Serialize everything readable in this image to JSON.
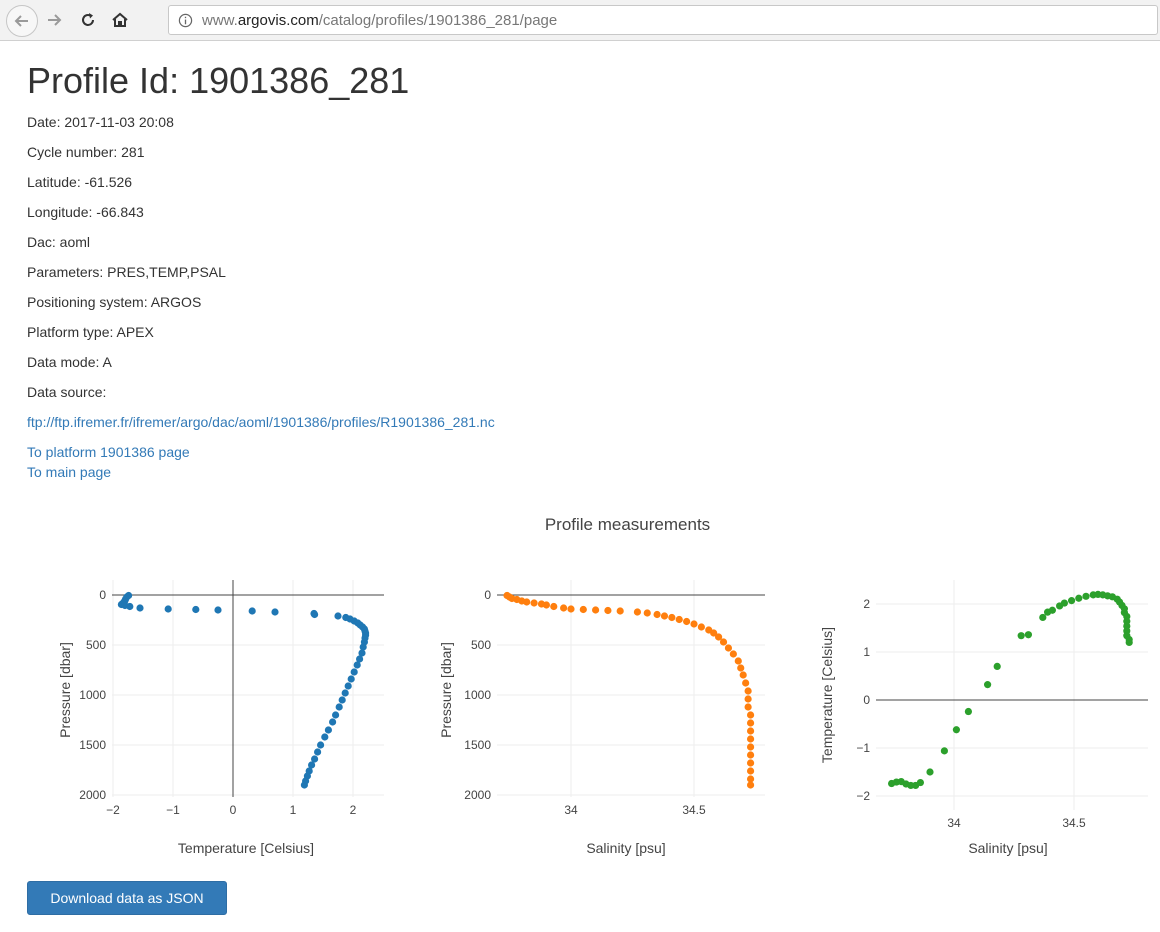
{
  "browser": {
    "url_prefix": "www.",
    "url_domain": "argovis.com",
    "url_path": "/catalog/profiles/1901386_281/page"
  },
  "profile": {
    "title": "Profile Id: 1901386_281",
    "date": "Date: 2017-11-03 20:08",
    "cycle": "Cycle number: 281",
    "latitude": "Latitude: -61.526",
    "longitude": "Longitude: -66.843",
    "dac": "Dac: aoml",
    "parameters": "Parameters: PRES,TEMP,PSAL",
    "positioning": "Positioning system: ARGOS",
    "platform_type": "Platform type: APEX",
    "data_mode": "Data mode: A",
    "data_source_label": "Data source:",
    "data_source_url": "ftp://ftp.ifremer.fr/ifremer/argo/dac/aoml/1901386/profiles/R1901386_281.nc",
    "platform_link": "To platform 1901386 page",
    "main_link": "To main page"
  },
  "download_label": "Download data as JSON",
  "chart_data": [
    {
      "type": "scatter",
      "title": "Profile measurements",
      "xlabel": "Temperature [Celsius]",
      "ylabel": "Pressure [dbar]",
      "xlim": [
        -2,
        2.5
      ],
      "ylim": [
        2000,
        0
      ],
      "reversed_y": true,
      "grid": true,
      "color": "#1f77b4",
      "xticks": [
        "−2",
        "−1",
        "0",
        "1",
        "2"
      ],
      "yticks": [
        "0",
        "500",
        "1000",
        "1500",
        "2000"
      ],
      "points": [
        [
          -1.74,
          5
        ],
        [
          -1.77,
          20
        ],
        [
          -1.79,
          40
        ],
        [
          -1.8,
          55
        ],
        [
          -1.81,
          65
        ],
        [
          -1.82,
          75
        ],
        [
          -1.84,
          85
        ],
        [
          -1.86,
          95
        ],
        [
          -1.8,
          105
        ],
        [
          -1.72,
          115
        ],
        [
          -1.55,
          130
        ],
        [
          -1.08,
          140
        ],
        [
          -0.62,
          145
        ],
        [
          -0.25,
          150
        ],
        [
          0.32,
          160
        ],
        [
          0.7,
          170
        ],
        [
          1.35,
          185
        ],
        [
          1.36,
          195
        ],
        [
          1.75,
          210
        ],
        [
          1.88,
          225
        ],
        [
          1.95,
          240
        ],
        [
          2.02,
          260
        ],
        [
          2.08,
          280
        ],
        [
          2.12,
          300
        ],
        [
          2.16,
          320
        ],
        [
          2.19,
          340
        ],
        [
          2.2,
          360
        ],
        [
          2.21,
          380
        ],
        [
          2.21,
          400
        ],
        [
          2.2,
          430
        ],
        [
          2.19,
          470
        ],
        [
          2.17,
          520
        ],
        [
          2.15,
          580
        ],
        [
          2.11,
          640
        ],
        [
          2.07,
          700
        ],
        [
          2.02,
          770
        ],
        [
          1.97,
          840
        ],
        [
          1.92,
          910
        ],
        [
          1.87,
          980
        ],
        [
          1.82,
          1050
        ],
        [
          1.77,
          1120
        ],
        [
          1.71,
          1200
        ],
        [
          1.66,
          1270
        ],
        [
          1.59,
          1350
        ],
        [
          1.53,
          1420
        ],
        [
          1.46,
          1500
        ],
        [
          1.41,
          1570
        ],
        [
          1.36,
          1640
        ],
        [
          1.31,
          1700
        ],
        [
          1.27,
          1760
        ],
        [
          1.24,
          1810
        ],
        [
          1.21,
          1860
        ],
        [
          1.19,
          1900
        ]
      ]
    },
    {
      "type": "scatter",
      "xlabel": "Salinity [psu]",
      "ylabel": "Pressure [dbar]",
      "xlim": [
        33.73,
        34.78
      ],
      "ylim": [
        2000,
        0
      ],
      "reversed_y": true,
      "grid": true,
      "color": "#ff7f0e",
      "xticks": [
        "34",
        "34.5"
      ],
      "yticks": [
        "0",
        "500",
        "1000",
        "1500",
        "2000"
      ],
      "points": [
        [
          33.74,
          5
        ],
        [
          33.75,
          20
        ],
        [
          33.76,
          35
        ],
        [
          33.78,
          45
        ],
        [
          33.8,
          60
        ],
        [
          33.82,
          70
        ],
        [
          33.85,
          80
        ],
        [
          33.88,
          90
        ],
        [
          33.9,
          100
        ],
        [
          33.93,
          115
        ],
        [
          33.97,
          130
        ],
        [
          34.0,
          140
        ],
        [
          34.05,
          145
        ],
        [
          34.1,
          150
        ],
        [
          34.15,
          155
        ],
        [
          34.2,
          160
        ],
        [
          34.27,
          170
        ],
        [
          34.31,
          180
        ],
        [
          34.35,
          195
        ],
        [
          34.38,
          210
        ],
        [
          34.41,
          225
        ],
        [
          34.44,
          245
        ],
        [
          34.47,
          265
        ],
        [
          34.5,
          290
        ],
        [
          34.53,
          320
        ],
        [
          34.56,
          350
        ],
        [
          34.58,
          380
        ],
        [
          34.6,
          420
        ],
        [
          34.62,
          470
        ],
        [
          34.64,
          530
        ],
        [
          34.66,
          590
        ],
        [
          34.68,
          660
        ],
        [
          34.69,
          730
        ],
        [
          34.7,
          800
        ],
        [
          34.71,
          880
        ],
        [
          34.72,
          960
        ],
        [
          34.72,
          1040
        ],
        [
          34.72,
          1120
        ],
        [
          34.73,
          1200
        ],
        [
          34.73,
          1280
        ],
        [
          34.73,
          1360
        ],
        [
          34.73,
          1440
        ],
        [
          34.73,
          1520
        ],
        [
          34.73,
          1600
        ],
        [
          34.73,
          1680
        ],
        [
          34.73,
          1760
        ],
        [
          34.73,
          1840
        ],
        [
          34.73,
          1900
        ]
      ]
    },
    {
      "type": "scatter",
      "xlabel": "Salinity [psu]",
      "ylabel": "Temperature [Celsius]",
      "xlim": [
        33.72,
        34.78
      ],
      "ylim": [
        -2.1,
        2.3
      ],
      "grid": true,
      "color": "#2ca02c",
      "xticks": [
        "34",
        "34.5"
      ],
      "yticks": [
        "−2",
        "−1",
        "0",
        "1",
        "2"
      ],
      "points": [
        [
          33.74,
          -1.74
        ],
        [
          33.76,
          -1.71
        ],
        [
          33.78,
          -1.7
        ],
        [
          33.8,
          -1.75
        ],
        [
          33.82,
          -1.78
        ],
        [
          33.84,
          -1.78
        ],
        [
          33.86,
          -1.72
        ],
        [
          33.9,
          -1.5
        ],
        [
          33.96,
          -1.06
        ],
        [
          34.01,
          -0.62
        ],
        [
          34.06,
          -0.24
        ],
        [
          34.14,
          0.32
        ],
        [
          34.18,
          0.7
        ],
        [
          34.28,
          1.34
        ],
        [
          34.31,
          1.36
        ],
        [
          34.37,
          1.72
        ],
        [
          34.39,
          1.83
        ],
        [
          34.41,
          1.87
        ],
        [
          34.44,
          1.96
        ],
        [
          34.46,
          2.02
        ],
        [
          34.49,
          2.07
        ],
        [
          34.52,
          2.12
        ],
        [
          34.55,
          2.16
        ],
        [
          34.58,
          2.19
        ],
        [
          34.6,
          2.2
        ],
        [
          34.62,
          2.19
        ],
        [
          34.64,
          2.17
        ],
        [
          34.66,
          2.15
        ],
        [
          34.68,
          2.1
        ],
        [
          34.69,
          2.04
        ],
        [
          34.7,
          1.97
        ],
        [
          34.71,
          1.9
        ],
        [
          34.71,
          1.82
        ],
        [
          34.72,
          1.74
        ],
        [
          34.72,
          1.64
        ],
        [
          34.72,
          1.54
        ],
        [
          34.72,
          1.44
        ],
        [
          34.72,
          1.34
        ],
        [
          34.73,
          1.26
        ],
        [
          34.73,
          1.2
        ]
      ]
    }
  ]
}
